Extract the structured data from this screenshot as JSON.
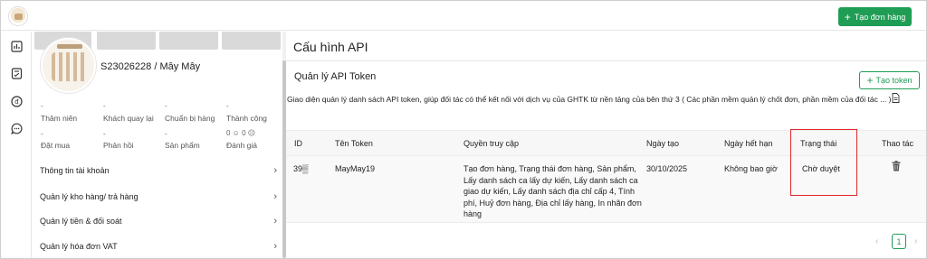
{
  "header": {
    "create_order_label": "Tạo đơn hàng"
  },
  "profile": {
    "username": "S23026228 / Mây Mây",
    "stats": [
      {
        "value": "-",
        "label": "Thâm niên"
      },
      {
        "value": "-",
        "label": "Khách quay lại"
      },
      {
        "value": "-",
        "label": "Chuẩn bị hàng"
      },
      {
        "value": "-",
        "label": "Thành công"
      },
      {
        "value": "-",
        "label": "Đặt mua"
      },
      {
        "value": "-",
        "label": "Phản hồi"
      },
      {
        "value": "-",
        "label": "Sản phẩm"
      },
      {
        "value": "0 ☺ 0 ☹",
        "label": "Đánh giá"
      }
    ],
    "menu": [
      "Thông tin tài khoản",
      "Quản lý kho hàng/ trả hàng",
      "Quản lý tiền & đối soát",
      "Quản lý hóa đơn VAT"
    ]
  },
  "main": {
    "page_title": "Cấu hình API",
    "section_title": "Quản lý API Token",
    "create_token_label": "Tạo token",
    "description": "Giao diện quản lý danh sách API token, giúp đối tác có thể kết nối với dịch vụ của GHTK từ nền tảng của bên thứ 3 ( Các phần mềm quản lý chốt đơn, phần mềm của đối tác ... )",
    "columns": [
      "ID",
      "Tên Token",
      "Quyền truy cập",
      "Ngày tạo",
      "Ngày hết hạn",
      "Trạng thái",
      "Thao tác"
    ],
    "rows": [
      {
        "id": "39▒",
        "token_name": "MayMay19",
        "access_lines": [
          "Tạo đơn hàng, Trạng thái đơn hàng, Sản phẩm,",
          "Lấy danh sách ca lấy dự kiến, Lấy danh sách ca",
          "giao dự kiến, Lấy danh sách địa chỉ cấp 4, Tính",
          "phí, Huỷ đơn hàng, Địa chỉ lấy hàng, In nhãn đơn",
          "hàng"
        ],
        "created": "30/10/2025",
        "expires": "Không bao giờ",
        "status": "Chờ duyệt"
      }
    ],
    "pagination": {
      "prev": "‹",
      "page": "1",
      "next": "›"
    }
  },
  "colors": {
    "primary": "#1f9d55",
    "highlight": "#e0262b"
  }
}
